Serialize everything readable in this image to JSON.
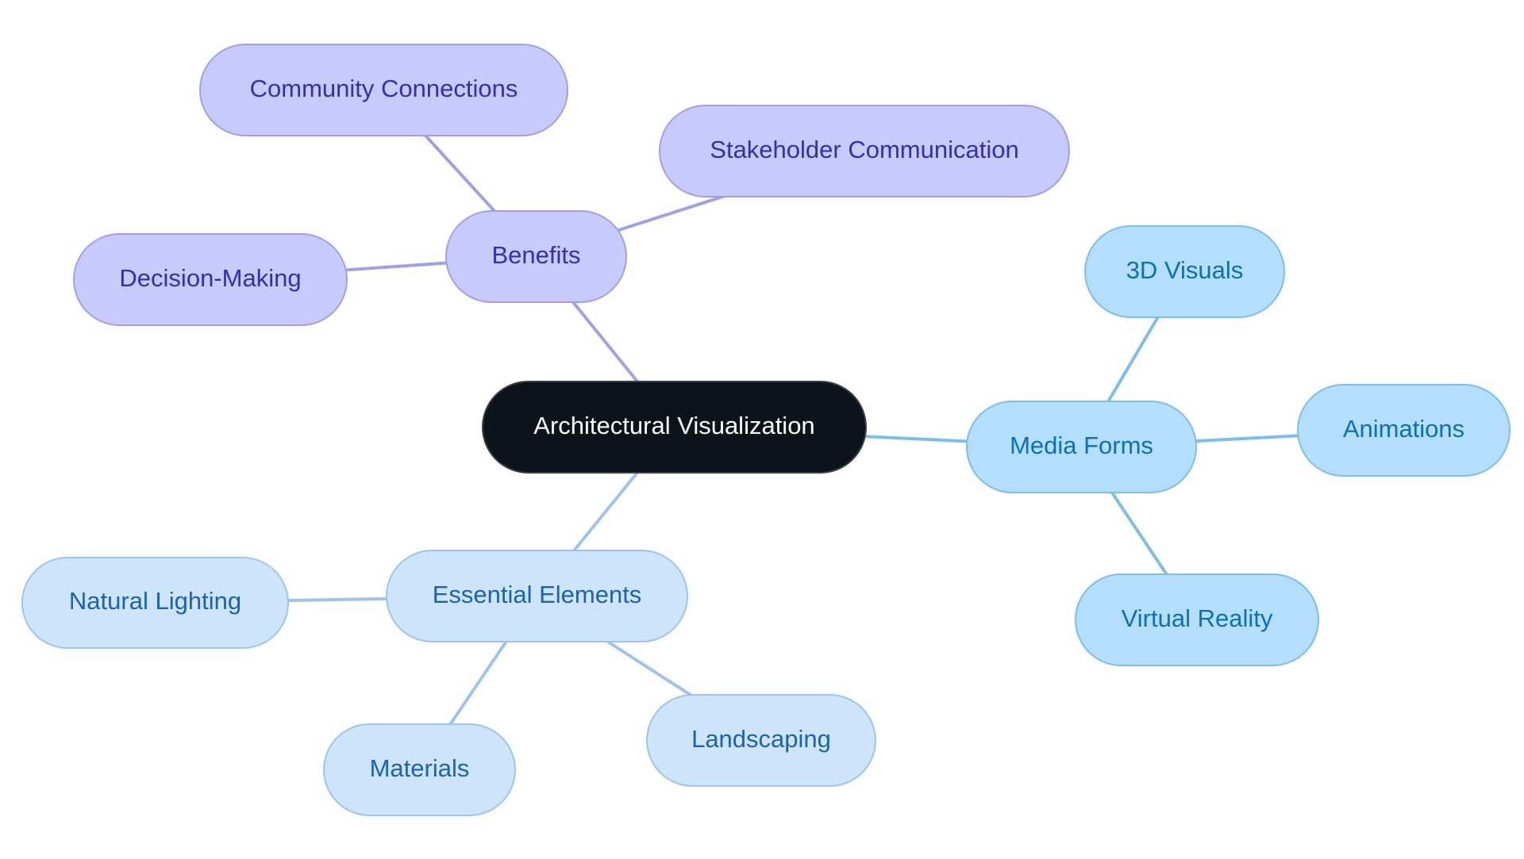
{
  "title": "Architectural Visualization",
  "colors": {
    "root_fill": "#0c131b",
    "root_text": "#ffffff",
    "purple_fill": "#c8cafd",
    "purple_stroke": "#9fa1e6",
    "purple_text": "#3130b2",
    "sky_fill": "#b3dffd",
    "sky_stroke": "#7fbde9",
    "sky_text": "#0e6fb4",
    "pale_fill": "#cde4fb",
    "pale_stroke": "#9dc4ec",
    "pale_text": "#1b63b0"
  },
  "nodes": {
    "root": {
      "label": "Architectural Visualization"
    },
    "benefits": {
      "label": "Benefits"
    },
    "community": {
      "label": "Community Connections"
    },
    "stakeholder": {
      "label": "Stakeholder Communication"
    },
    "decision": {
      "label": "Decision-Making"
    },
    "media": {
      "label": "Media Forms"
    },
    "visuals3d": {
      "label": "3D Visuals"
    },
    "animations": {
      "label": "Animations"
    },
    "vr": {
      "label": "Virtual Reality"
    },
    "essential": {
      "label": "Essential Elements"
    },
    "lighting": {
      "label": "Natural Lighting"
    },
    "materials": {
      "label": "Materials"
    },
    "landscaping": {
      "label": "Landscaping"
    }
  },
  "edges": [
    {
      "from": "root",
      "to": "benefits",
      "group": "purple"
    },
    {
      "from": "benefits",
      "to": "community",
      "group": "purple"
    },
    {
      "from": "benefits",
      "to": "stakeholder",
      "group": "purple"
    },
    {
      "from": "benefits",
      "to": "decision",
      "group": "purple"
    },
    {
      "from": "root",
      "to": "media",
      "group": "sky"
    },
    {
      "from": "media",
      "to": "visuals3d",
      "group": "sky"
    },
    {
      "from": "media",
      "to": "animations",
      "group": "sky"
    },
    {
      "from": "media",
      "to": "vr",
      "group": "sky"
    },
    {
      "from": "root",
      "to": "essential",
      "group": "pale"
    },
    {
      "from": "essential",
      "to": "lighting",
      "group": "pale"
    },
    {
      "from": "essential",
      "to": "materials",
      "group": "pale"
    },
    {
      "from": "essential",
      "to": "landscaping",
      "group": "pale"
    }
  ]
}
